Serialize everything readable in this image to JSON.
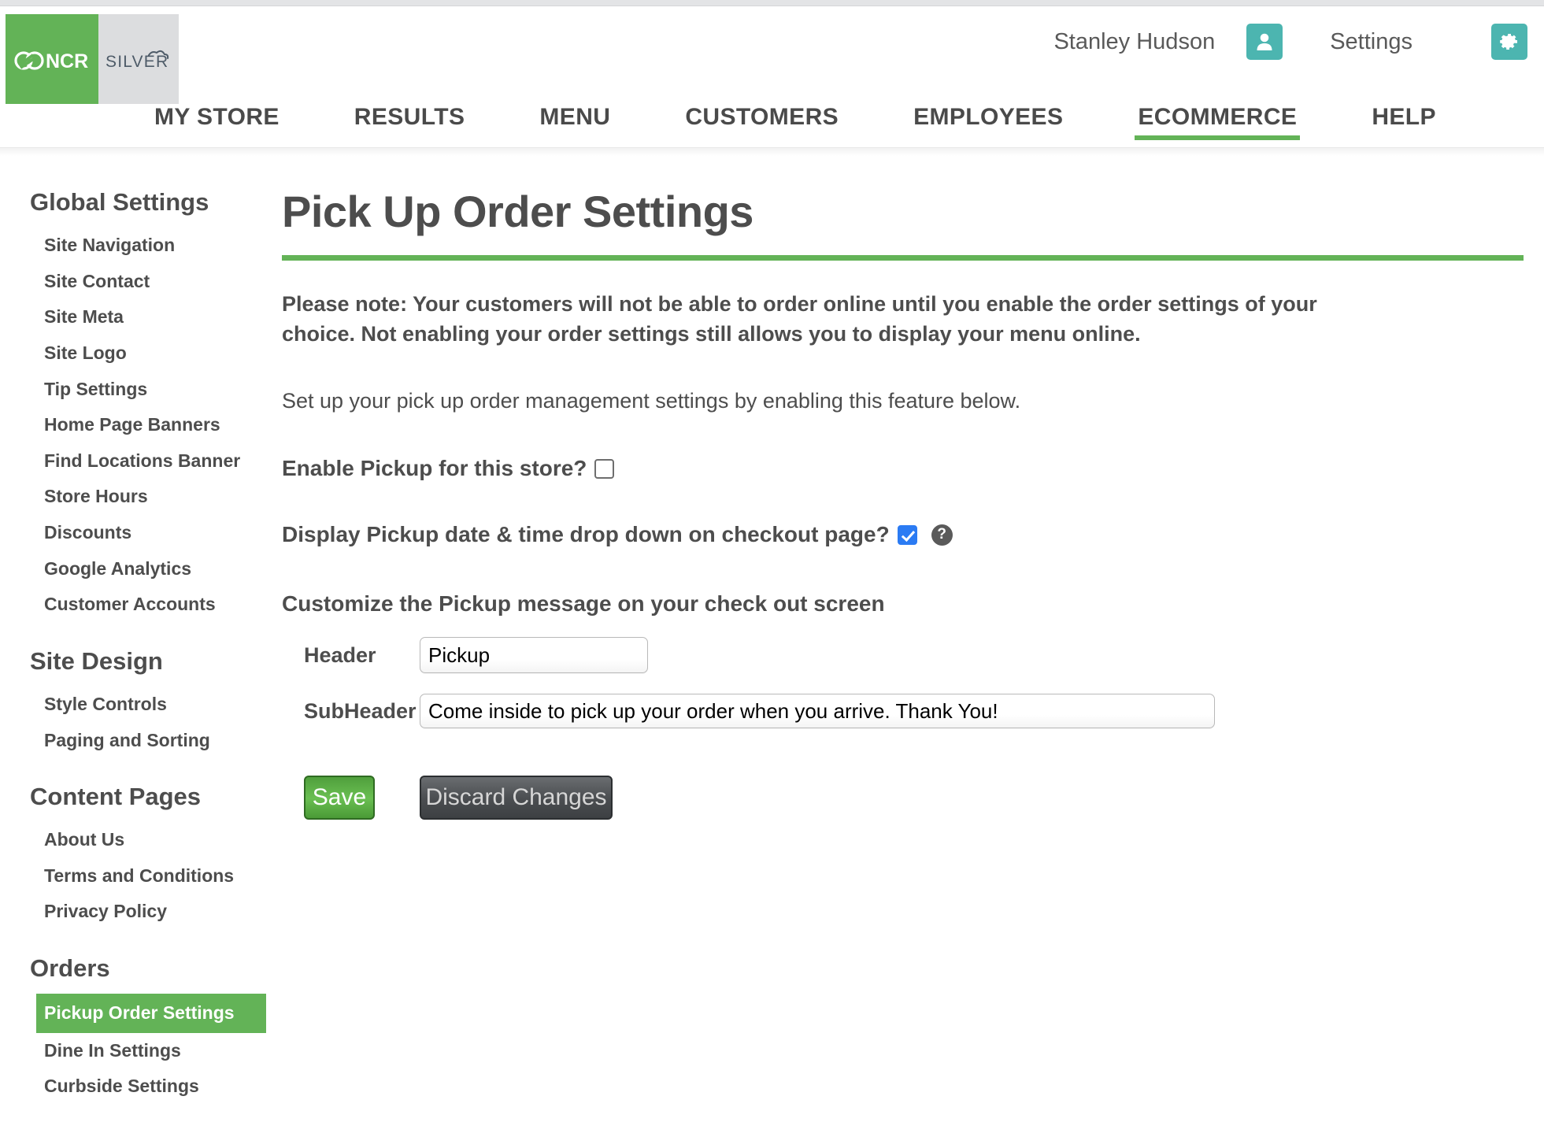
{
  "header": {
    "logo_primary": "NCR",
    "logo_secondary": "SILVER",
    "user_name": "Stanley Hudson",
    "user_icon": "user-icon",
    "settings_label": "Settings",
    "settings_icon": "gear-icon"
  },
  "nav": {
    "items": [
      {
        "label": "MY STORE",
        "active": false
      },
      {
        "label": "RESULTS",
        "active": false
      },
      {
        "label": "MENU",
        "active": false
      },
      {
        "label": "CUSTOMERS",
        "active": false
      },
      {
        "label": "EMPLOYEES",
        "active": false
      },
      {
        "label": "ECOMMERCE",
        "active": true
      },
      {
        "label": "HELP",
        "active": false
      }
    ]
  },
  "sidebar": {
    "sections": [
      {
        "heading": "Global Settings",
        "items": [
          "Site Navigation",
          "Site Contact",
          "Site Meta",
          "Site Logo",
          "Tip Settings",
          "Home Page Banners",
          "Find Locations Banner",
          "Store Hours",
          "Discounts",
          "Google Analytics",
          "Customer Accounts"
        ]
      },
      {
        "heading": "Site Design",
        "items": [
          "Style Controls",
          "Paging and Sorting"
        ]
      },
      {
        "heading": "Content Pages",
        "items": [
          "About Us",
          "Terms and Conditions",
          "Privacy Policy"
        ]
      },
      {
        "heading": "Orders",
        "items": [
          "Pickup Order Settings",
          "Dine In Settings",
          "Curbside Settings"
        ]
      }
    ],
    "active_item": "Pickup Order Settings"
  },
  "main": {
    "title": "Pick Up Order Settings",
    "note": "Please note: Your customers will not be able to order online until you enable the order settings of your choice. Not enabling your order settings still allows you to display your menu online.",
    "subnote": "Set up your pick up order management settings by enabling this feature below.",
    "enable_pickup_label": "Enable Pickup for this store?",
    "enable_pickup_checked": false,
    "display_dropdown_label": "Display Pickup date & time drop down on checkout page?",
    "display_dropdown_checked": true,
    "help_icon_glyph": "?",
    "customize_label": "Customize the Pickup message on your check out screen",
    "fields": {
      "header_label": "Header",
      "header_value": "Pickup",
      "subheader_label": "SubHeader",
      "subheader_value": "Come inside to pick up your order when you arrive. Thank You!"
    },
    "save_label": "Save",
    "discard_label": "Discard Changes"
  },
  "colors": {
    "brand_green": "#63b357",
    "teal": "#4cb5b0",
    "checkbox_blue": "#2b7bf3",
    "text_gray": "#4d4d4d",
    "silver_bg": "#dcdddf"
  }
}
